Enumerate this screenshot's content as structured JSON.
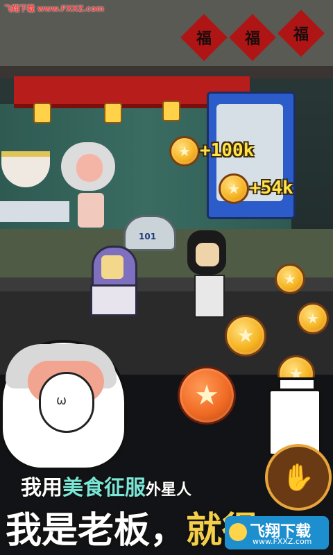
{
  "watermark_top": "飞翔下载 www.FXXZ.com",
  "fu_character": "福",
  "robot_label": "101",
  "bonus_texts": [
    "+100k",
    "+54k"
  ],
  "icons": {
    "coin": "star-coin-icon",
    "tap_button": "hand-tap-icon",
    "face_symbol": "ω"
  },
  "slogan_line1": {
    "part1": "我用",
    "highlight": "美食征服",
    "part2": "外星人"
  },
  "slogan_line2": {
    "part1": "我是老板，",
    "highlight": "就得"
  },
  "watermark_bottom": {
    "title": "飞翔下载",
    "url": "www.FXXZ.com"
  },
  "colors": {
    "coin_gold": "#f5b321",
    "bonus_yellow": "#ffe14a",
    "slogan_teal": "#79e6d6",
    "awning_red": "#b61d1b"
  }
}
